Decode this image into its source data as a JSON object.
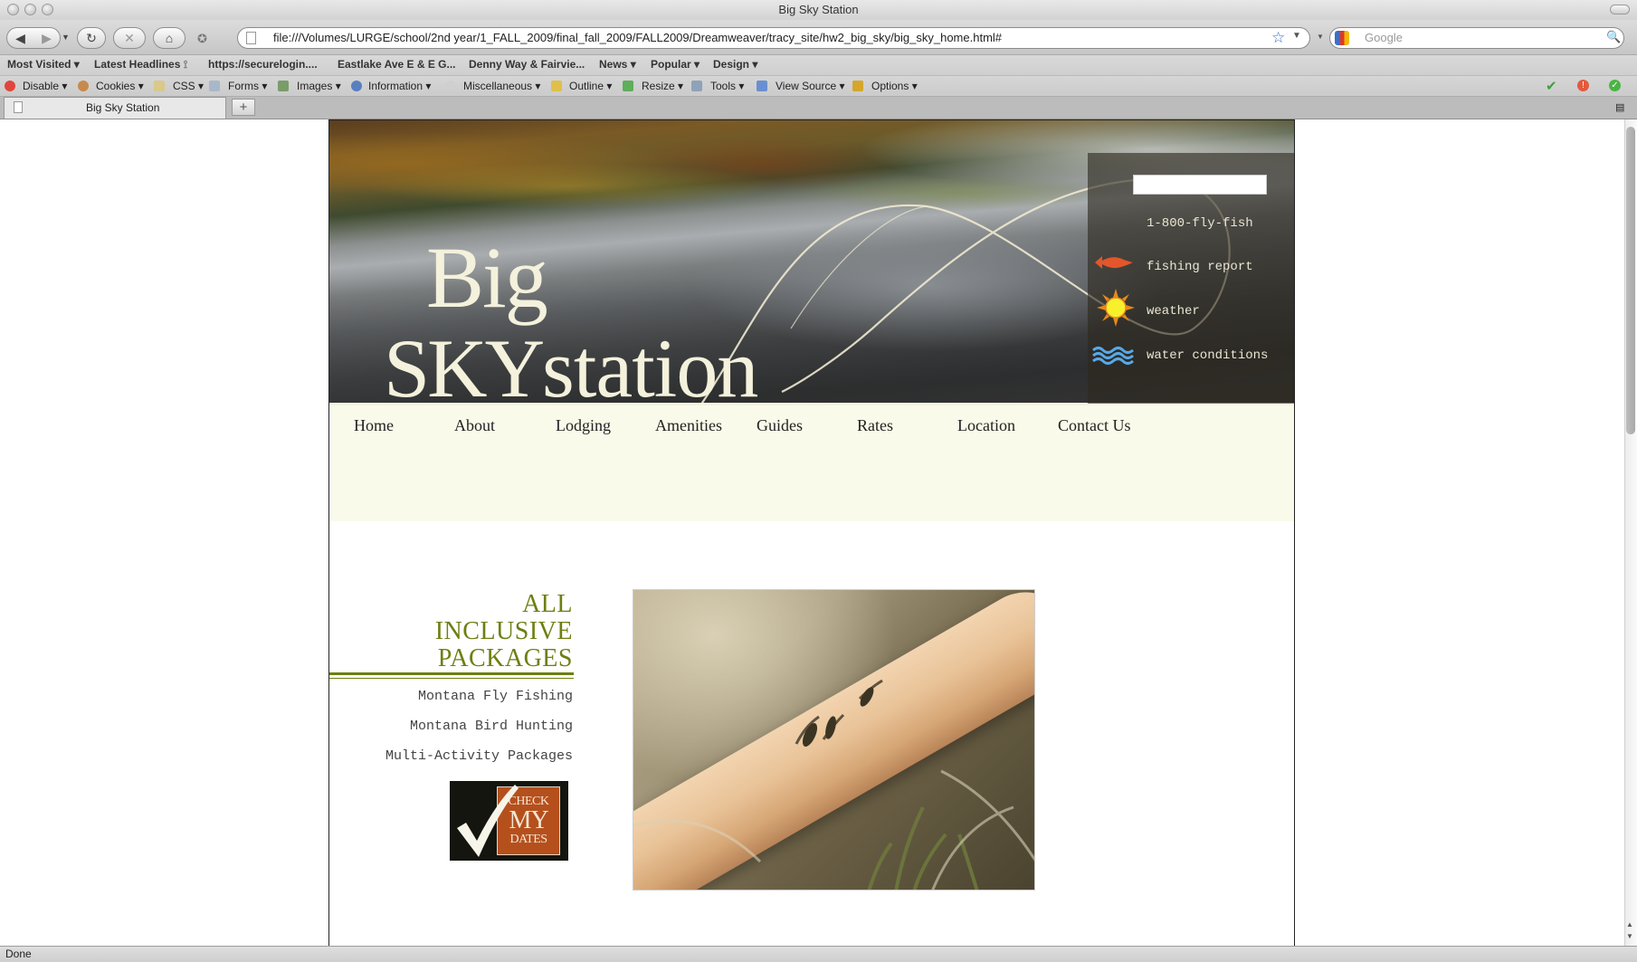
{
  "browser": {
    "window_title": "Big Sky Station",
    "url": "file:///Volumes/LURGE/school/2nd year/1_FALL_2009/final_fall_2009/FALL2009/Dreamweaver/tracy_site/hw2_big_sky/big_sky_home.html#",
    "search_placeholder": "Google",
    "status": "Done",
    "tab_title": "Big Sky Station",
    "new_tab": "+",
    "bookmarks": [
      "Most Visited",
      "Latest Headlines",
      "https://securelogin....",
      "Eastlake Ave E & E G...",
      "Denny Way & Fairvie...",
      "News",
      "Popular",
      "Design"
    ],
    "dev_toolbar": [
      "Disable",
      "Cookies",
      "CSS",
      "Forms",
      "Images",
      "Information",
      "Miscellaneous",
      "Outline",
      "Resize",
      "Tools",
      "View Source",
      "Options"
    ],
    "icons": {
      "back": "back-arrow-icon",
      "forward": "forward-arrow-icon",
      "reload": "reload-icon",
      "stop": "stop-icon",
      "home": "home-icon",
      "bookmark_star": "star-icon",
      "search": "magnifier-icon"
    }
  },
  "site": {
    "logo": {
      "line1": "Big",
      "line2_a": "SKY",
      "line2_b": "station"
    },
    "side_panel": {
      "phone": "1-800-fly-fish",
      "fishing_report": "fishing report",
      "weather": "weather",
      "water_conditions": "water conditions"
    },
    "nav": [
      "Home",
      "About",
      "Lodging",
      "Amenities",
      "Guides",
      "Rates",
      "Location",
      "Contact Us"
    ],
    "packages": {
      "title_lines": [
        "ALL",
        "INCLUSIVE",
        "PACKAGES"
      ],
      "items": [
        "Montana Fly Fishing",
        "Montana Bird Hunting",
        "Multi-Activity Packages"
      ]
    },
    "check_dates": {
      "line1": "CHECK",
      "line2": "MY",
      "line3": "DATES"
    },
    "colors": {
      "accent_olive": "#6e7f12",
      "nav_bg": "#fafaea",
      "badge_orange": "#b5501d",
      "logo_cream": "#f4f1dc"
    }
  }
}
